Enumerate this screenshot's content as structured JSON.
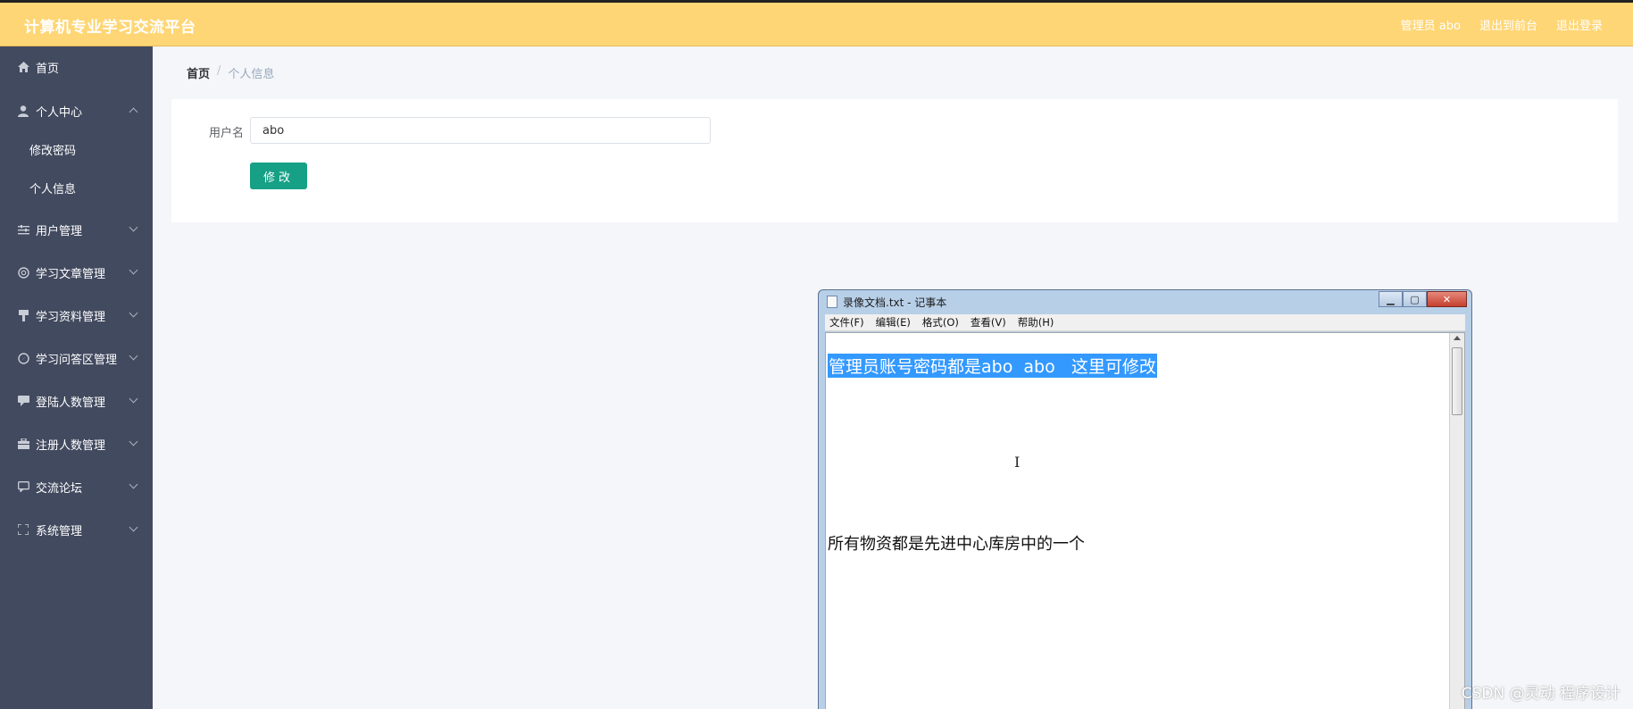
{
  "header": {
    "title": "计算机专业学习交流平台",
    "user": "管理员 abo",
    "back_frontend": "退出到前台",
    "logout": "退出登录",
    "color": "#ffd675"
  },
  "sidebar": {
    "color": "#424a5f",
    "items": [
      {
        "label": "首页",
        "icon": "home-icon"
      },
      {
        "label": "个人中心",
        "icon": "user-icon",
        "expanded": true
      },
      {
        "label": "修改密码",
        "sub": true
      },
      {
        "label": "个人信息",
        "sub": true
      },
      {
        "label": "用户管理",
        "icon": "sliders-icon"
      },
      {
        "label": "学习文章管理",
        "icon": "circle-icon"
      },
      {
        "label": "学习资料管理",
        "icon": "bookmark-icon"
      },
      {
        "label": "学习问答区管理",
        "icon": "compass-icon"
      },
      {
        "label": "登陆人数管理",
        "icon": "chat-icon"
      },
      {
        "label": "注册人数管理",
        "icon": "briefcase-icon"
      },
      {
        "label": "交流论坛",
        "icon": "message-icon"
      },
      {
        "label": "系统管理",
        "icon": "fullscreen-icon"
      }
    ]
  },
  "breadcrumb": {
    "home": "首页",
    "separator": "/",
    "current": "个人信息"
  },
  "form": {
    "username_label": "用户名",
    "username_value": "abo",
    "submit_label": "修改",
    "button_color": "#16a085"
  },
  "notepad": {
    "title": "录像文档.txt - 记事本",
    "menu": [
      "文件(F)",
      "编辑(E)",
      "格式(O)",
      "查看(V)",
      "帮助(H)"
    ],
    "line1": "管理员账号密码都是abo  abo   这里可修改",
    "line2": "所有物资都是先进中心库房中的一个",
    "cursor": "I"
  },
  "watermark": "CSDN @灵动 程序设计"
}
